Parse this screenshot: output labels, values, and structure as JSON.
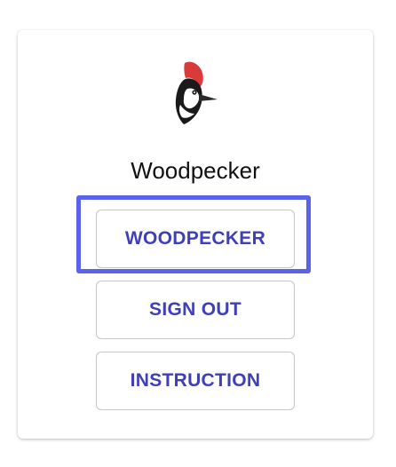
{
  "app": {
    "title": "Woodpecker",
    "logo_icon": "woodpecker-logo-icon"
  },
  "buttons": {
    "woodpecker_label": "WOODPECKER",
    "sign_out_label": "SIGN OUT",
    "instruction_label": "INSTRUCTION"
  },
  "colors": {
    "button_text": "#3f3fb8",
    "focus_outline": "#5b63ea",
    "logo_crest": "#d93b3b"
  },
  "focused_button": "WOODPECKER"
}
